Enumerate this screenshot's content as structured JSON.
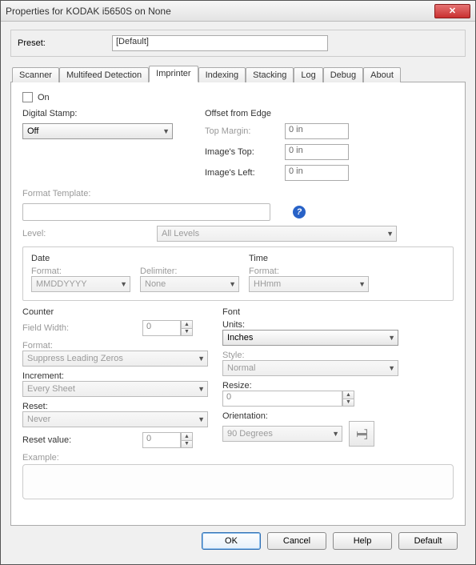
{
  "window": {
    "title": "Properties for KODAK i5650S on None"
  },
  "preset": {
    "label": "Preset:",
    "value": "[Default]"
  },
  "tabs": [
    {
      "label": "Scanner"
    },
    {
      "label": "Multifeed Detection"
    },
    {
      "label": "Imprinter"
    },
    {
      "label": "Indexing"
    },
    {
      "label": "Stacking"
    },
    {
      "label": "Log"
    },
    {
      "label": "Debug"
    },
    {
      "label": "About"
    }
  ],
  "on": {
    "label": "On",
    "checked": false
  },
  "digital_stamp": {
    "label": "Digital Stamp:",
    "value": "Off"
  },
  "offset": {
    "title": "Offset from Edge",
    "top_margin_label": "Top Margin:",
    "top_margin_value": "0 in",
    "images_top_label": "Image's Top:",
    "images_top_value": "0 in",
    "images_left_label": "Image's Left:",
    "images_left_value": "0 in"
  },
  "format_template": {
    "label": "Format Template:",
    "value": ""
  },
  "level": {
    "label": "Level:",
    "value": "All Levels"
  },
  "date": {
    "title": "Date",
    "format_label": "Format:",
    "format_value": "MMDDYYYY",
    "delimiter_label": "Delimiter:",
    "delimiter_value": "None"
  },
  "time": {
    "title": "Time",
    "format_label": "Format:",
    "format_value": "HHmm"
  },
  "counter": {
    "title": "Counter",
    "field_width_label": "Field Width:",
    "field_width_value": "0",
    "format_label": "Format:",
    "format_value": "Suppress Leading Zeros",
    "increment_label": "Increment:",
    "increment_value": "Every Sheet",
    "reset_label": "Reset:",
    "reset_value": "Never",
    "reset_value_label": "Reset value:",
    "reset_value_num": "0"
  },
  "font": {
    "title": "Font",
    "units_label": "Units:",
    "units_value": "Inches",
    "style_label": "Style:",
    "style_value": "Normal",
    "resize_label": "Resize:",
    "resize_value": "0",
    "orientation_label": "Orientation:",
    "orientation_value": "90 Degrees"
  },
  "example": {
    "label": "Example:"
  },
  "buttons": {
    "ok": "OK",
    "cancel": "Cancel",
    "help": "Help",
    "default": "Default"
  }
}
